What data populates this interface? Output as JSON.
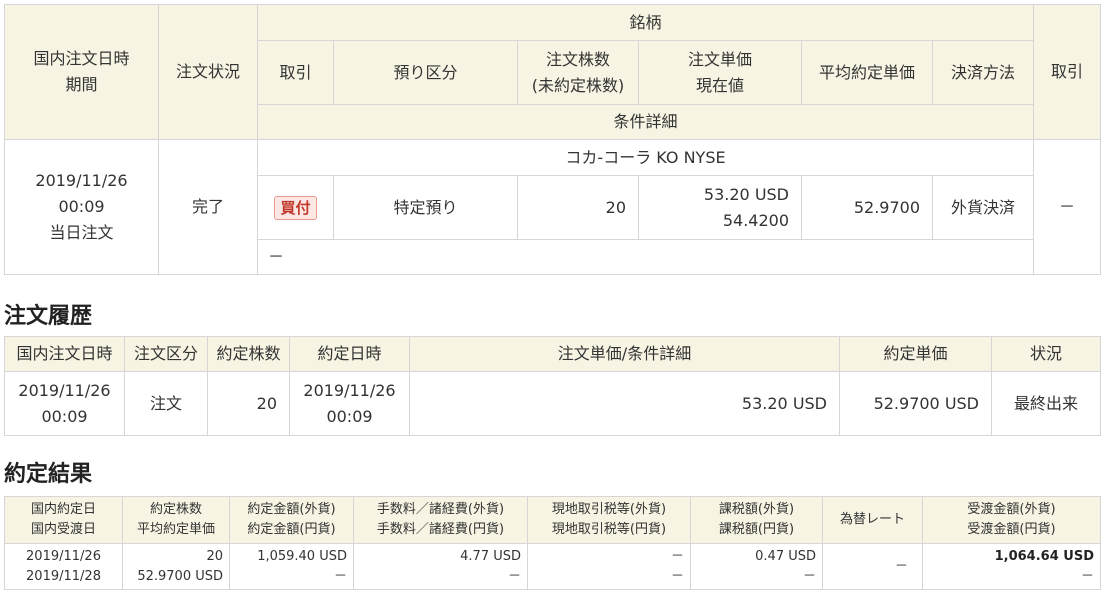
{
  "order": {
    "headers": {
      "date_period_1": "国内注文日時",
      "date_period_2": "期間",
      "status": "注文状況",
      "issue": "銘柄",
      "trade": "取引",
      "custody": "預り区分",
      "qty_1": "注文株数",
      "qty_2": "(未約定株数)",
      "price_1": "注文単価",
      "price_2": "現在値",
      "avg_price": "平均約定単価",
      "settlement": "決済方法",
      "cancel": "取引",
      "conditions": "条件詳細"
    },
    "row": {
      "date": "2019/11/26",
      "time": "00:09",
      "period": "当日注文",
      "status": "完了",
      "issue_name": "コカ-コーラ KO NYSE",
      "trade_badge": "買付",
      "custody": "特定預り",
      "qty": "20",
      "order_price": "53.20 USD",
      "current_price": "54.4200",
      "avg_price": "52.9700",
      "settlement": "外貨決済",
      "cancel": "－",
      "conditions": "－"
    }
  },
  "history": {
    "title": "注文履歴",
    "headers": [
      "国内注文日時",
      "注文区分",
      "約定株数",
      "約定日時",
      "注文単価/条件詳細",
      "約定単価",
      "状況"
    ],
    "row": {
      "order_date": "2019/11/26",
      "order_time": "00:09",
      "type": "注文",
      "qty": "20",
      "exec_date": "2019/11/26",
      "exec_time": "00:09",
      "price_detail": "53.20 USD",
      "exec_price": "52.9700 USD",
      "status": "最終出来"
    }
  },
  "result": {
    "title": "約定結果",
    "headers": {
      "h1a": "国内約定日",
      "h1b": "国内受渡日",
      "h2a": "約定株数",
      "h2b": "平均約定単価",
      "h3a": "約定金額(外貨)",
      "h3b": "約定金額(円貨)",
      "h4a": "手数料／諸経費(外貨)",
      "h4b": "手数料／諸経費(円貨)",
      "h5a": "現地取引税等(外貨)",
      "h5b": "現地取引税等(円貨)",
      "h6a": "課税額(外貨)",
      "h6b": "課税額(円貨)",
      "h7": "為替レート",
      "h8a": "受渡金額(外貨)",
      "h8b": "受渡金額(円貨)"
    },
    "row": {
      "exec_date": "2019/11/26",
      "settle_date": "2019/11/28",
      "qty": "20",
      "avg_price": "52.9700 USD",
      "amount_fx": "1,059.40 USD",
      "amount_jpy": "－",
      "fee_fx": "4.77 USD",
      "fee_jpy": "－",
      "tax_local_fx": "－",
      "tax_local_jpy": "－",
      "taxable_fx": "0.47 USD",
      "taxable_jpy": "－",
      "fx_rate": "－",
      "settle_fx": "1,064.64 USD",
      "settle_jpy": "－"
    }
  }
}
